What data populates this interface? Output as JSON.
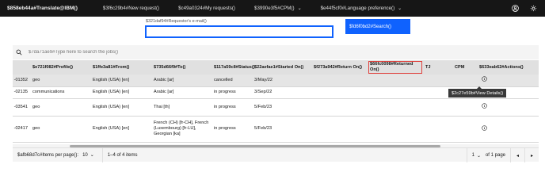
{
  "header": {
    "brand": "$858eb44a#Translate@IBM()",
    "nav": [
      {
        "label": "$3f6c29b4#New request()",
        "dropdown": false
      },
      {
        "label": "$c49a0324#My requests()",
        "dropdown": false
      },
      {
        "label": "$3990e3f5#CPM()",
        "dropdown": true
      },
      {
        "label": "$e44f5cf0#Language preference()",
        "dropdown": true
      }
    ],
    "icons": [
      "user-icon",
      "settings-icon"
    ]
  },
  "form": {
    "requestor_label": "$321daf94#Requestor's e-mail()",
    "requestor_value": "",
    "search_button": "$fd6f0bd2#Search()"
  },
  "table_search": {
    "placeholder": "$7da71ae9#Type here to search the jobs()"
  },
  "table": {
    "columns": [
      "",
      "$e721f082#Profile()",
      "$1ffe3a81#From()",
      "$735d66f9#To()",
      "$117a59c8#Status()",
      "$22aefae1#Started On()",
      "$f273a942#Return On()",
      "$66fc0098#Returned On()",
      "TJ",
      "CPM",
      "$633eab62#Actions()"
    ],
    "highlighted_column": "$66fc0098#Returned On()",
    "rows": [
      {
        "id": "01352-",
        "profile": "geo",
        "from": "English (USA) [en]",
        "to": "Arabic [ar]",
        "status": "cancelled",
        "started": "3/May/22",
        "return_on": "",
        "returned_on": "",
        "tj": "",
        "cpm": ""
      },
      {
        "id": "02135-",
        "profile": "communications",
        "from": "English (USA) [en]",
        "to": "Arabic [ar]",
        "status": "in progress",
        "started": "3/Sep/22",
        "return_on": "",
        "returned_on": "",
        "tj": "",
        "cpm": ""
      },
      {
        "id": "03541-",
        "profile": "geo",
        "from": "English (USA) [en]",
        "to": "Thai [th]",
        "status": "in progress",
        "started": "5/Feb/23",
        "return_on": "",
        "returned_on": "",
        "tj": "",
        "cpm": ""
      },
      {
        "id": "02417-",
        "profile": "geo",
        "from": "English (USA) [en]",
        "to": "French (CH) [fr-CH], French (Luxembourg) [fr-LU], Georgian [ka]",
        "status": "in progress",
        "started": "5/Feb/23",
        "return_on": "",
        "returned_on": "",
        "tj": "",
        "cpm": ""
      }
    ],
    "action_icon": "info-icon",
    "tooltip": "$2c27e59b#View Details()"
  },
  "pagination": {
    "items_per_page_label": "$afb68d7c#Items per page():",
    "items_per_page_value": "10",
    "range_text": "1–4 of 4 items",
    "page_value": "1",
    "of_pages": "of 1 page"
  },
  "colors": {
    "topbar": "#161616",
    "primary": "#0f62fe",
    "header_bg": "#e0e0e0",
    "highlight": "#e0403c"
  }
}
